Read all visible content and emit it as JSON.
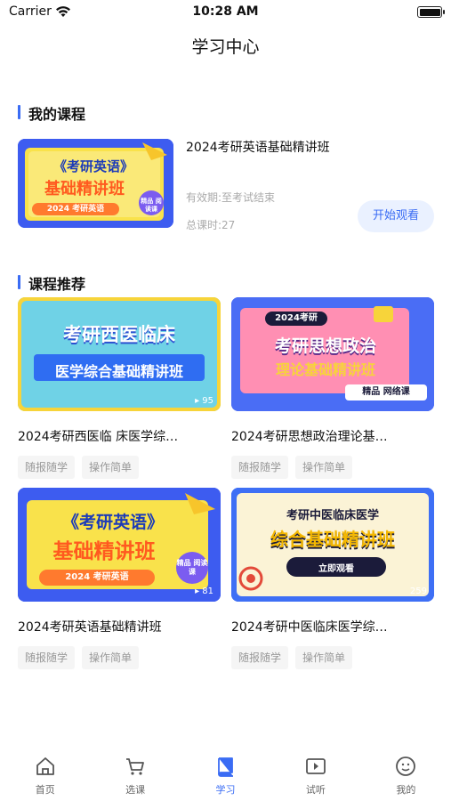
{
  "status": {
    "carrier": "Carrier",
    "time": "10:28 AM"
  },
  "nav": {
    "title": "学习中心"
  },
  "my_courses": {
    "heading": "我的课程",
    "item": {
      "title": "2024考研英语基础精讲班",
      "validity": "有效期:至考试结束",
      "hours": "总课时:27",
      "watch_label": "开始观看",
      "thumb": {
        "line1": "《考研英语》",
        "line2": "基础精讲班",
        "line3": "2024 考研英语",
        "badge": "精品 阅读课"
      }
    }
  },
  "recommend": {
    "heading": "课程推荐",
    "courses": [
      {
        "title": "2024考研西医临 床医学综…",
        "tags": [
          "随报随学",
          "操作简单"
        ],
        "thumb": {
          "line1": "考研西医临床",
          "line2": "医学综合基础精讲班",
          "count": "95"
        }
      },
      {
        "title": "2024考研思想政治理论基…",
        "tags": [
          "随报随学",
          "操作简单"
        ],
        "thumb": {
          "year": "2024考研",
          "line1": "考研思想政治",
          "line2": "理论基础精讲班",
          "badge": "精品 网络课"
        }
      },
      {
        "title": "2024考研英语基础精讲班",
        "tags": [
          "随报随学",
          "操作简单"
        ],
        "thumb": {
          "line1": "《考研英语》",
          "line2": "基础精讲班",
          "line3": "2024 考研英语",
          "count": "81",
          "badge": "精品 阅读课"
        }
      },
      {
        "title": "2024考研中医临床医学综…",
        "tags": [
          "随报随学",
          "操作简单"
        ],
        "thumb": {
          "line1": "考研中医临床医学",
          "line2": "综合基础精讲班",
          "cta": "立即观看",
          "count": "259"
        }
      }
    ]
  },
  "tabbar": {
    "items": [
      {
        "label": "首页",
        "icon": "home-icon"
      },
      {
        "label": "选课",
        "icon": "cart-icon"
      },
      {
        "label": "学习",
        "icon": "book-icon"
      },
      {
        "label": "试听",
        "icon": "video-icon"
      },
      {
        "label": "我的",
        "icon": "face-icon"
      }
    ],
    "active_index": 2
  },
  "colors": {
    "accent": "#3a6cf4",
    "muted": "#aaaaaa",
    "tag_bg": "#f5f5f5"
  }
}
